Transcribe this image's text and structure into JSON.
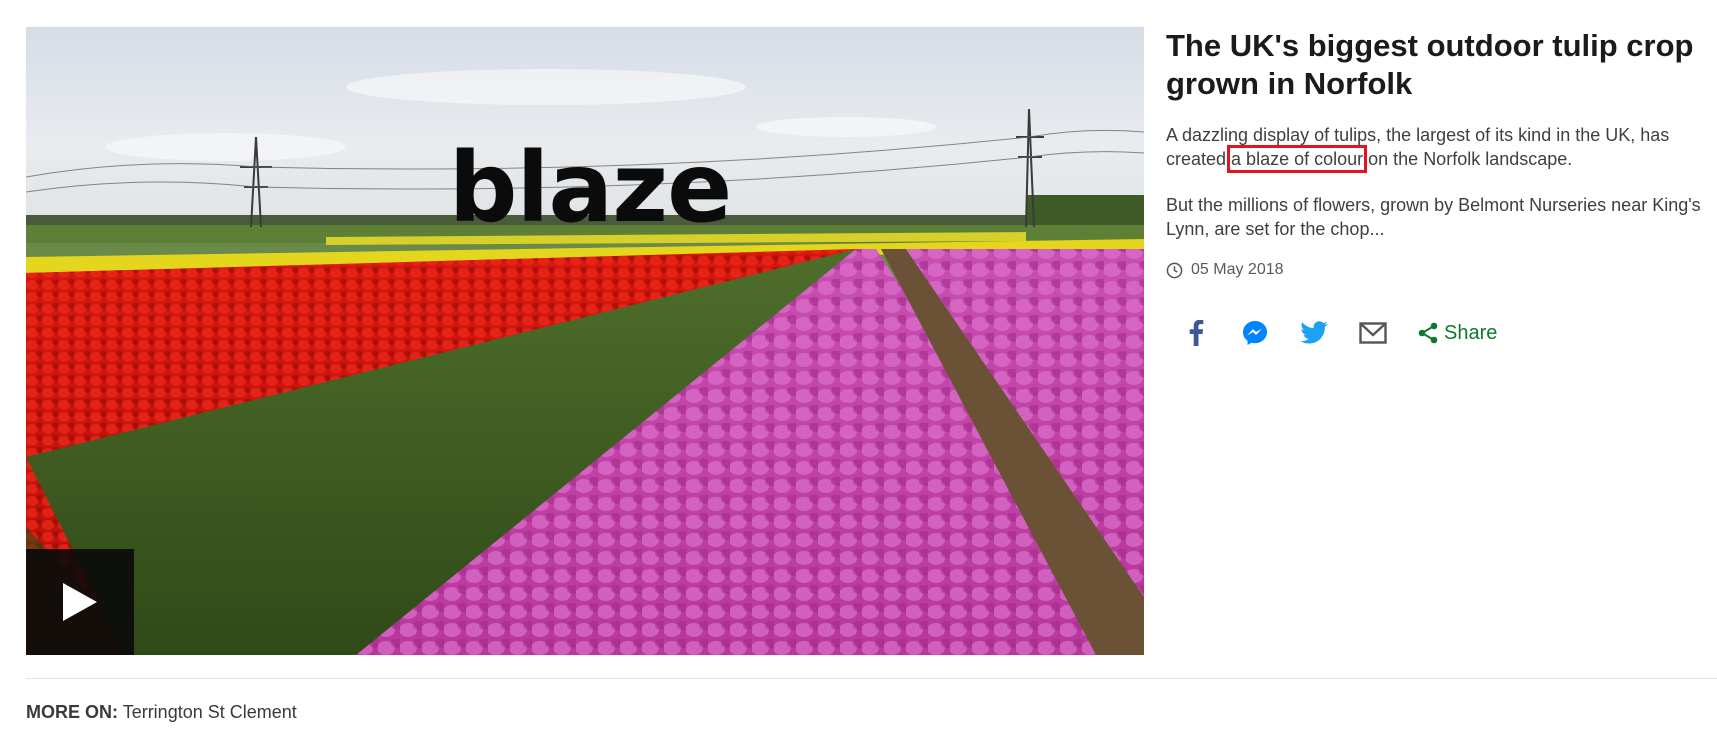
{
  "media": {
    "overlay_word": "blaze",
    "play_button_icon": "play-icon"
  },
  "article": {
    "headline": "The UK's biggest outdoor tulip crop grown in Norfolk",
    "summary_1_before": "A dazzling display of tulips, the largest of its kind in the UK, has created ",
    "summary_1_highlight": "a blaze of colour",
    "summary_1_after": " on the Norfolk landscape.",
    "summary_2": "But the millions of flowers, grown by Belmont Nurseries near King's Lynn, are set for the chop...",
    "date": "05 May 2018",
    "highlight_color": "#e1141f"
  },
  "share": {
    "icons": [
      "facebook-icon",
      "messenger-icon",
      "twitter-icon",
      "email-icon"
    ],
    "share_label": "Share",
    "share_color": "#0b7a2e"
  },
  "more_on": {
    "label": "MORE ON:",
    "topic": "Terrington St Clement"
  }
}
